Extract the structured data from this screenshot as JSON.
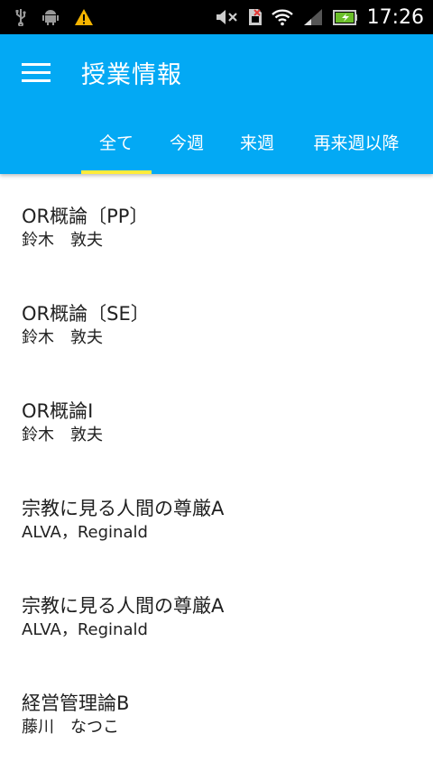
{
  "status_bar": {
    "time": "17:26",
    "left_icons": [
      "usb-icon",
      "android-icon",
      "warning-icon"
    ],
    "right_icons": [
      "mute-icon",
      "no-sim-icon",
      "wifi-icon",
      "signal-icon",
      "battery-icon"
    ]
  },
  "app_bar": {
    "title": "授業情報",
    "menu_icon": "menu-icon",
    "color": "#03a9f4",
    "indicator_color": "#ffeb3b"
  },
  "tabs": [
    {
      "label": "全て",
      "selected": true
    },
    {
      "label": "今週",
      "selected": false
    },
    {
      "label": "来週",
      "selected": false
    },
    {
      "label": "再来週以降",
      "selected": false
    }
  ],
  "courses": [
    {
      "name": "OR概論〔PP〕",
      "teacher": "鈴木　敦夫"
    },
    {
      "name": "OR概論〔SE〕",
      "teacher": "鈴木　敦夫"
    },
    {
      "name": "OR概論I",
      "teacher": "鈴木　敦夫"
    },
    {
      "name": "宗教に見る人間の尊厳A",
      "teacher": "ALVA，Reginald"
    },
    {
      "name": "宗教に見る人間の尊厳A",
      "teacher": "ALVA，Reginald"
    },
    {
      "name": "経営管理論B",
      "teacher": "藤川　なつこ"
    }
  ]
}
